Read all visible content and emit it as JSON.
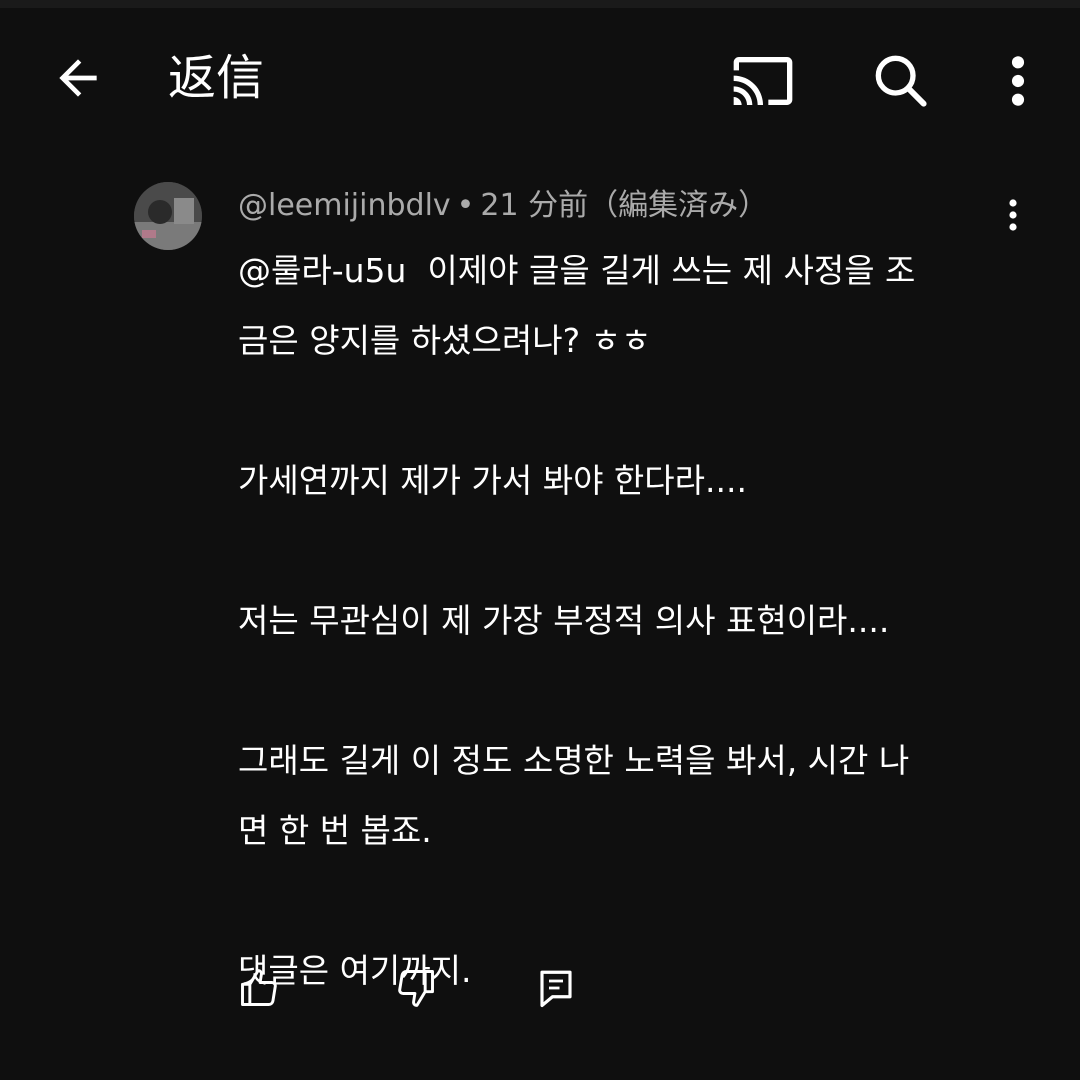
{
  "app_bar": {
    "title": "返信",
    "icons": {
      "back": "arrow-left-icon",
      "cast": "cast-icon",
      "search": "search-icon",
      "more": "more-vert-icon"
    }
  },
  "comment": {
    "author": "@leemijinbdlv",
    "separator": "•",
    "time": "21 分前（編集済み）",
    "avatar": "avatar",
    "paragraphs": [
      "@룰라-u5u  이제야 글을 길게 쓰는 제 사정을 조\n금은 양지를 하셨으려나? ㅎㅎ",
      "가세연까지 제가 가서 봐야 한다라....",
      "저는 무관심이 제 가장 부정적 의사 표현이라....",
      "그래도 길게 이 정도 소명한 노력을 봐서, 시간 나\n면 한 번 봅죠.",
      "댓글은 여기까지."
    ],
    "actions": {
      "like": "thumb-up-icon",
      "dislike": "thumb-down-icon",
      "reply": "reply-icon"
    }
  },
  "colors": {
    "background": "#0f0f0f",
    "text_primary": "#ffffff",
    "text_secondary": "#aaaaaa"
  }
}
